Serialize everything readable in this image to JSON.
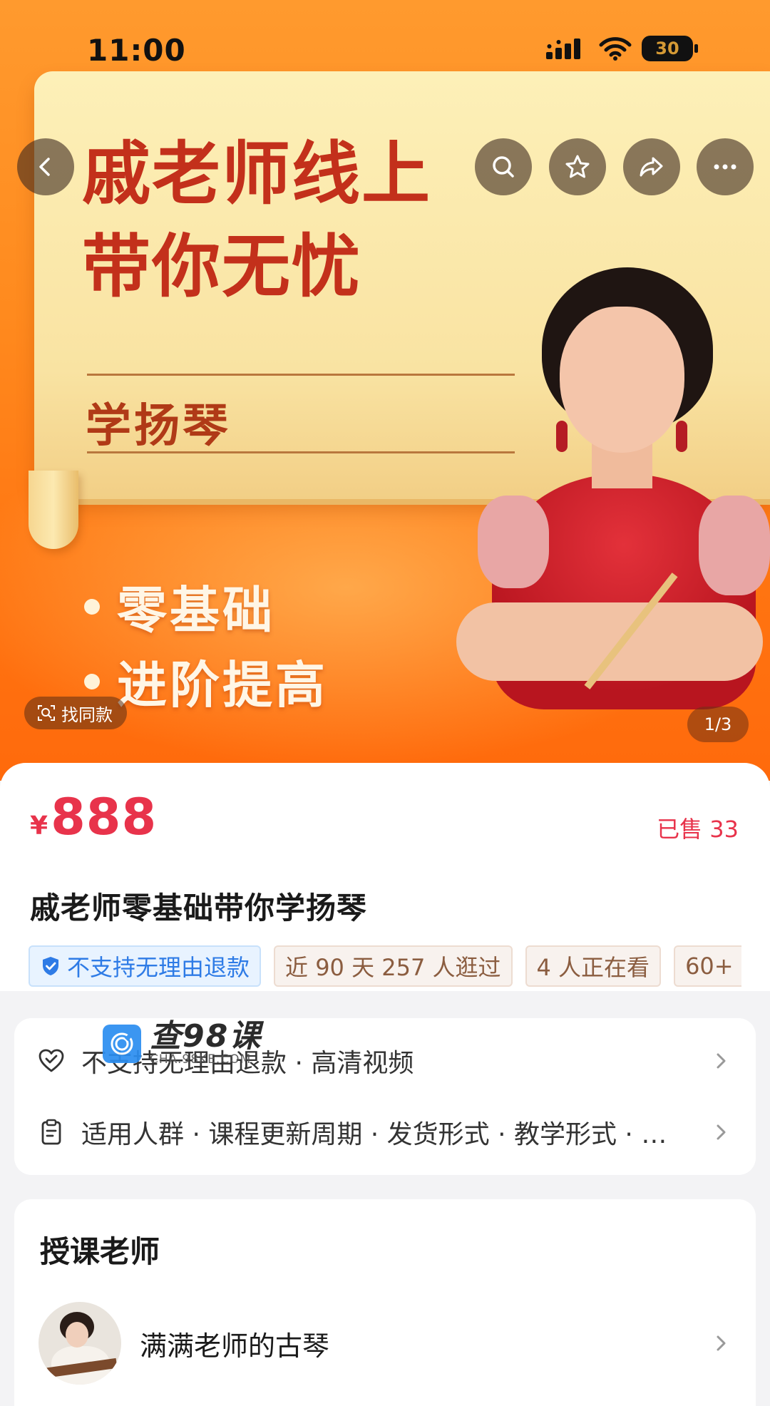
{
  "status_bar": {
    "time": "11:00",
    "battery": "30"
  },
  "nav": {
    "back_icon": "chevron-left-icon",
    "search_icon": "search-icon",
    "fav_icon": "star-icon",
    "share_icon": "share-icon",
    "more_icon": "more-icon"
  },
  "hero": {
    "line1": "戚老师线上",
    "line2": "带你无忧",
    "subject": "学扬琴",
    "bullets": [
      "零基础",
      "进阶提高"
    ],
    "find_same": "找同款",
    "page_indicator": "1/3"
  },
  "product": {
    "currency": "¥",
    "price": "888",
    "sold": "已售 33",
    "title": "戚老师零基础带你学扬琴",
    "tags": [
      "不支持无理由退款",
      "近 90 天 257 人逛过",
      "4 人正在看",
      "60+"
    ]
  },
  "services": [
    {
      "icon": "heart-shield-icon",
      "text": "不支持无理由退款 · 高清视频"
    },
    {
      "icon": "clipboard-icon",
      "text": "适用人群 · 课程更新周期 · 发货形式 · 教学形式 · …"
    }
  ],
  "watermark": {
    "main": "查98课",
    "sub": "CHA.98KE.COM"
  },
  "teacher": {
    "heading": "授课老师",
    "name": "满满老师的古琴"
  },
  "colors": {
    "price_red": "#e8334b",
    "hero_orange": "#ff8a1e",
    "title_red": "#c3301b"
  }
}
